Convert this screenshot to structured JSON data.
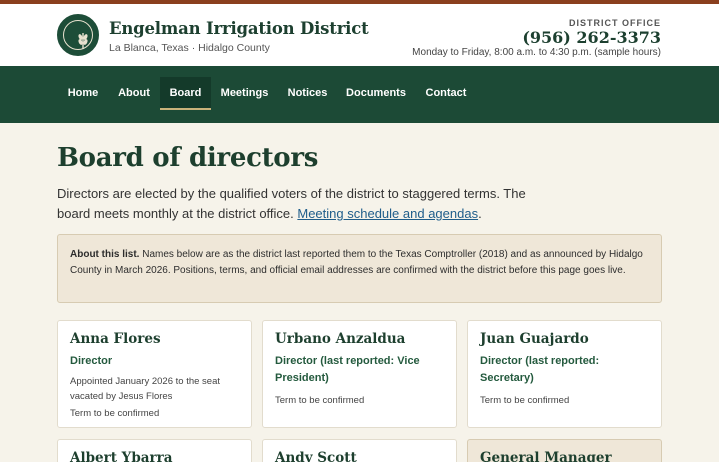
{
  "site": {
    "title": "Engelman Irrigation District",
    "subtitle": "La Blanca, Texas · Hidalgo County",
    "office_label": "DISTRICT OFFICE",
    "office_phone": "(956) 262-3373",
    "office_hours": "Monday to Friday, 8:00 a.m. to 4:30 p.m. (sample hours)"
  },
  "nav": {
    "items": [
      {
        "label": "Home"
      },
      {
        "label": "About"
      },
      {
        "label": "Board",
        "active": true
      },
      {
        "label": "Meetings"
      },
      {
        "label": "Notices"
      },
      {
        "label": "Documents"
      },
      {
        "label": "Contact"
      }
    ]
  },
  "main": {
    "heading": "Board of directors",
    "intro_text": "Directors are elected by the qualified voters of the district to staggered terms. The board meets monthly at the district office. ",
    "intro_link": "Meeting schedule and agendas",
    "intro_end": ".",
    "notice_label": "About this list.",
    "notice_text": " Names below are as the district last reported them to the Texas Comptroller (2018) and as announced by Hidalgo County in March 2026. Positions, terms, and official email addresses are confirmed with the district before this page goes live."
  },
  "cards": [
    {
      "name": "Anna Flores",
      "role": "Director",
      "note": "Appointed January 2026 to the seat vacated by Jesus Flores",
      "term": "Term to be confirmed"
    },
    {
      "name": "Urbano Anzaldua",
      "role": "Director (last reported: Vice President)",
      "term": "Term to be confirmed"
    },
    {
      "name": "Juan Guajardo",
      "role": "Director (last reported: Secretary)",
      "term": "Term to be confirmed"
    },
    {
      "name": "Albert Ybarra"
    },
    {
      "name": "Andy Scott"
    },
    {
      "name": "General Manager"
    }
  ],
  "colors": {
    "brand_green": "#1c4a36",
    "accent_rust": "#8a3f1e",
    "link_blue": "#1f5d8a",
    "notice_bg": "#efe7d8"
  }
}
